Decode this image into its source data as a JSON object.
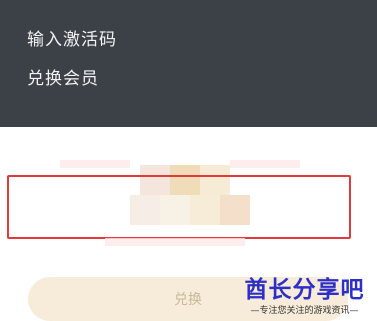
{
  "menu": {
    "items": [
      {
        "label": "输入激活码"
      },
      {
        "label": "兑换会员"
      }
    ]
  },
  "redeem": {
    "button_label": "兑换"
  },
  "watermark": {
    "title": "酋长分享吧",
    "subtitle": "—专注您关注的游戏资讯—"
  },
  "colors": {
    "header_bg": "#3b4147",
    "highlight_border": "#e03a3a",
    "button_bg": "#f6ecd9",
    "watermark_blue": "#2d2fc7"
  }
}
